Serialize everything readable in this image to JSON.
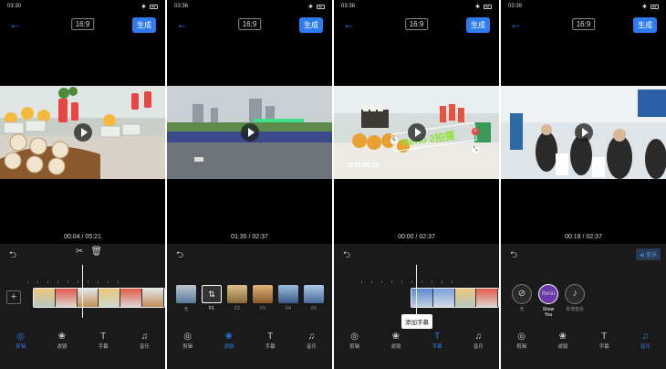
{
  "screens": [
    {
      "status_time": "03:30",
      "ratio": "16:9",
      "generate": "生成",
      "time": "00:04 / 05:21",
      "nav": [
        {
          "label": "剪辑",
          "icon": "edit-icon"
        },
        {
          "label": "滤镜",
          "icon": "filter-icon"
        },
        {
          "label": "字幕",
          "icon": "text-icon"
        },
        {
          "label": "音乐",
          "icon": "music-icon"
        }
      ],
      "active_nav": 0
    },
    {
      "status_time": "03:36",
      "ratio": "16:9",
      "generate": "生成",
      "time": "01:35 / 02:37",
      "filters": [
        "无",
        "F1",
        "F2",
        "F3",
        "F4",
        "F5"
      ],
      "active_nav": 1
    },
    {
      "status_time": "03:38",
      "ratio": "16:9",
      "generate": "生成",
      "time": "00:00 / 02:37",
      "overlay_text": "Reno 2拍摄",
      "date_stamp": "2019.09.10",
      "add_caption": "添加字幕",
      "active_nav": 2
    },
    {
      "status_time": "03:39",
      "ratio": "16:9",
      "generate": "生成",
      "time": "00:19 / 02:37",
      "music_badge": "音乐",
      "music": [
        "无",
        "Show You",
        "本地音乐"
      ],
      "active_nav": 3
    }
  ],
  "colors": {
    "accent": "#2f7bf0",
    "panel": "#1a1a1a"
  }
}
